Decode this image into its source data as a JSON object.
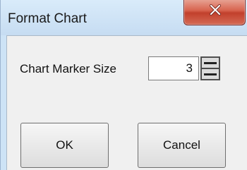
{
  "window": {
    "title": "Format Chart",
    "close_icon": "close-x-icon"
  },
  "form": {
    "marker_size_label": "Chart Marker Size",
    "marker_size_value": "3",
    "spinner_up_icon": "spin-up-icon",
    "spinner_down_icon": "spin-down-icon"
  },
  "buttons": {
    "ok_label": "OK",
    "cancel_label": "Cancel"
  },
  "colors": {
    "titlebar": "#cde3f6",
    "close_button": "#c2402c",
    "client_bg": "#f0f0f0"
  }
}
